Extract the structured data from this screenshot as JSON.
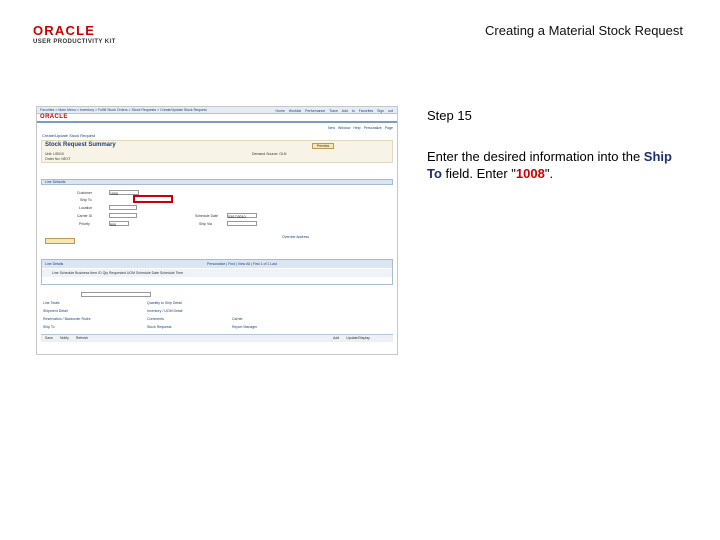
{
  "logo": {
    "brand": "ORACLE",
    "sub": "USER PRODUCTIVITY KIT"
  },
  "doc_title": "Creating a Material Stock Request",
  "step": "Step 15",
  "instruction": {
    "before": "Enter the desired information into the ",
    "field": "Ship To",
    "middle": " field. Enter \"",
    "value": "1008",
    "after": "\"."
  },
  "screenshot": {
    "nav": "Favorites > Main Menu > Inventory > Fulfill Stock Orders > Stock Requests > Create/Update Stock Request",
    "oracle": "ORACLE",
    "top_links": "Home  Worklist  Performance Trace  Add to Favorites  Sign out",
    "tool_links": "New Window  Help  Personalize Page",
    "breadcrumb": "Create/Update Stock Request",
    "page_title": "Stock Request Summary",
    "preview_btn": "Preview",
    "unit": "Unit: US010",
    "order_no": "Order No: NEXT",
    "demand": "Demand Source: OLN",
    "line_details": "Line Defaults",
    "labels": {
      "customer": "Customer",
      "ship_to": "Ship To",
      "location": "Location",
      "carrier": "Carrier ID",
      "priority": "Priority",
      "schedule_date": "Schedule Date",
      "ship_via": "Ship Via"
    },
    "customer_value": "1000",
    "priority_value": "500",
    "date_value": "03/17/2010",
    "notes": "Override Address",
    "line_detail": "Line Details",
    "pers": "Personalize | Find | View All | First 1 of 1 Last",
    "grid_cols": "Line  Schedule  Business  Item ID  Qty Requested  UOM  Schedule Date  Schedule Time",
    "bottom_links": [
      "Line Totals",
      "Shipment Detail",
      "Reservation / Backorder Rules",
      "Ship To",
      "Quantity to Ship Detail",
      "Inventory / UOM Detail",
      "Comments",
      "Stock Requests",
      "Carrier",
      "Report Manager"
    ],
    "footer_left": "Save  Notify  Refresh",
    "footer_right": "Add  Update/Display"
  }
}
